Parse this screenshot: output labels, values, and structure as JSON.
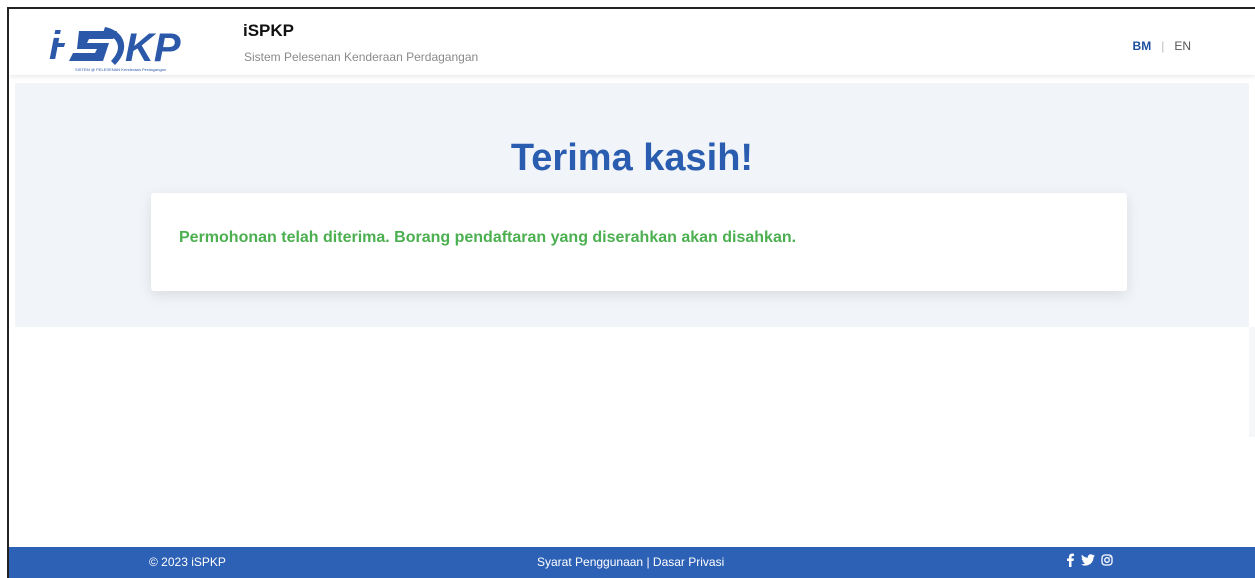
{
  "header": {
    "logo_text": "i-SPKP",
    "logo_tagline": "SISTEM @ PELESENAN Kenderaan Perdagangan",
    "title": "iSPKP",
    "subtitle": "Sistem Pelesenan Kenderaan Perdagangan",
    "lang": {
      "bm": "BM",
      "separator": "|",
      "en": "EN"
    }
  },
  "main": {
    "heading": "Terima kasih!",
    "message": "Permohonan telah diterima. Borang pendaftaran yang diserahkan akan disahkan."
  },
  "footer": {
    "copyright": "© 2023 iSPKP",
    "terms": "Syarat Penggunaan",
    "divider": "|",
    "privacy": "Dasar Privasi",
    "social": [
      "facebook-icon",
      "twitter-icon",
      "instagram-icon"
    ]
  },
  "colors": {
    "brand_blue": "#2a5db0",
    "footer_blue": "#2d61b6",
    "success_green": "#4caf50",
    "hero_bg": "#f1f5f9"
  }
}
